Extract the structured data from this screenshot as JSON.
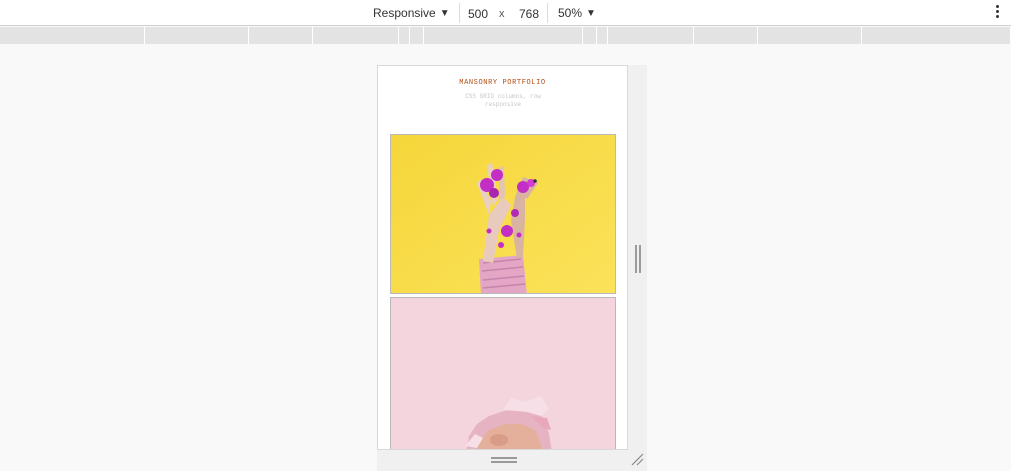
{
  "devtools": {
    "device_mode": "Responsive",
    "width": "500",
    "times": "x",
    "height": "768",
    "zoom": "50%"
  },
  "page": {
    "title": "MANSONRY PORTFOLIO",
    "subtitle": "CSS GRID columns, row responsive"
  },
  "colors": {
    "title": "#b04b12",
    "card1_bg": "#f7dd45",
    "card2_bg": "#f4d5de",
    "paint": "#c32fc4"
  },
  "images": [
    {
      "subject": "painted-hands-on-yellow"
    },
    {
      "subject": "face-through-pink-paper"
    }
  ]
}
